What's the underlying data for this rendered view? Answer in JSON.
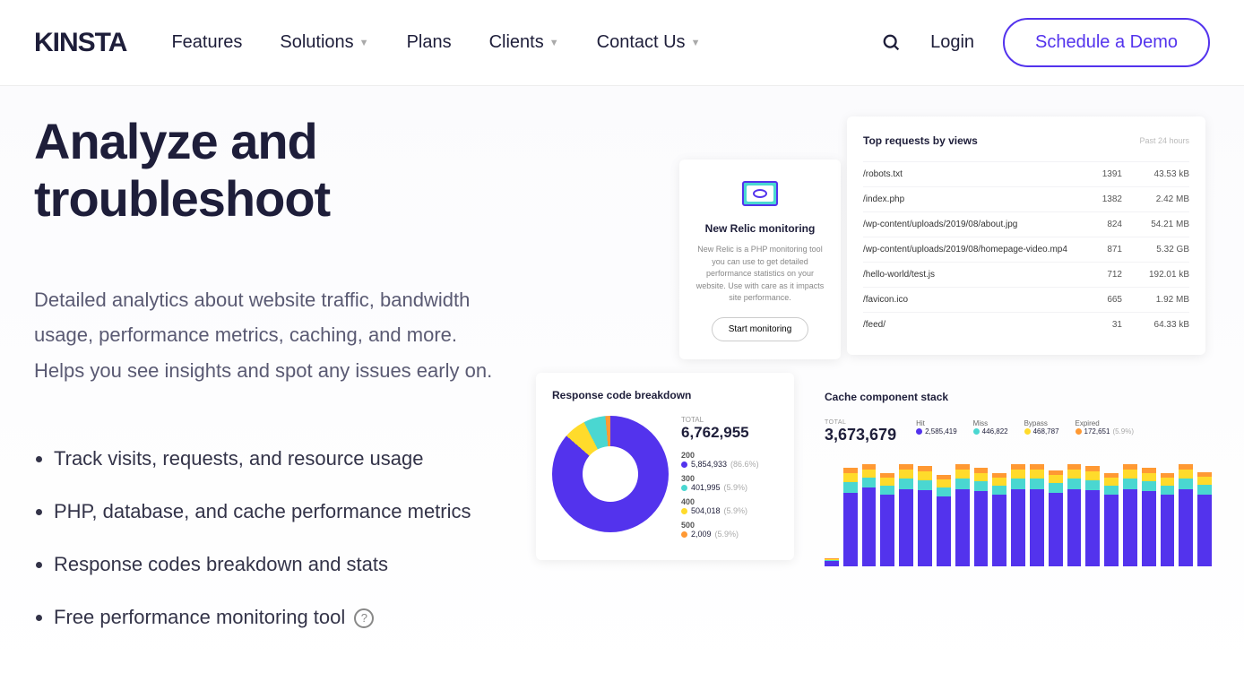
{
  "nav": {
    "logo": "KINSTA",
    "items": [
      "Features",
      "Solutions",
      "Plans",
      "Clients",
      "Contact Us"
    ],
    "dropdowns": [
      false,
      true,
      false,
      true,
      true
    ],
    "login": "Login",
    "cta": "Schedule a Demo"
  },
  "hero": {
    "title": "Analyze and troubleshoot",
    "description": "Detailed analytics about website traffic, bandwidth usage, performance metrics, caching, and more. Helps you see insights and spot any issues early on.",
    "features": [
      "Track visits, requests, and resource usage",
      "PHP, database, and cache performance metrics",
      "Response codes breakdown and stats",
      "Free performance monitoring tool"
    ]
  },
  "newrelic": {
    "title": "New Relic monitoring",
    "desc": "New Relic is a PHP monitoring tool you can use to get detailed performance statistics on your website. Use with care as it impacts site performance.",
    "button": "Start monitoring"
  },
  "requests": {
    "title": "Top requests by views",
    "period": "Past 24 hours",
    "rows": [
      {
        "path": "/robots.txt",
        "views": "1391",
        "size": "43.53 kB"
      },
      {
        "path": "/index.php",
        "views": "1382",
        "size": "2.42 MB"
      },
      {
        "path": "/wp-content/uploads/2019/08/about.jpg",
        "views": "824",
        "size": "54.21 MB"
      },
      {
        "path": "/wp-content/uploads/2019/08/homepage-video.mp4",
        "views": "871",
        "size": "5.32 GB"
      },
      {
        "path": "/hello-world/test.js",
        "views": "712",
        "size": "192.01 kB"
      },
      {
        "path": "/favicon.ico",
        "views": "665",
        "size": "1.92 MB"
      },
      {
        "path": "/feed/",
        "views": "31",
        "size": "64.33 kB"
      }
    ]
  },
  "response": {
    "title": "Response code breakdown",
    "total_label": "TOTAL",
    "total": "6,762,955",
    "codes": [
      {
        "code": "200",
        "value": "5,854,933",
        "pct": "(86.6%)",
        "color": "#5333ed"
      },
      {
        "code": "300",
        "value": "401,995",
        "pct": "(5.9%)",
        "color": "#4ad7d1"
      },
      {
        "code": "400",
        "value": "504,018",
        "pct": "(5.9%)",
        "color": "#ffdb2b"
      },
      {
        "code": "500",
        "value": "2,009",
        "pct": "(5.9%)",
        "color": "#ff9933"
      }
    ]
  },
  "cache": {
    "title": "Cache component stack",
    "total_label": "TOTAL",
    "total": "3,673,679",
    "legend": [
      {
        "label": "Hit",
        "value": "2,585,419",
        "color": "#5333ed"
      },
      {
        "label": "Miss",
        "value": "446,822",
        "color": "#4ad7d1"
      },
      {
        "label": "Bypass",
        "value": "468,787",
        "color": "#ffdb2b"
      },
      {
        "label": "Expired",
        "value": "172,651",
        "pct": "(5.9%)",
        "color": "#ff9933"
      }
    ],
    "chart_data": {
      "type": "bar-stacked",
      "series_colors": [
        "#5333ed",
        "#4ad7d1",
        "#ffdb2b",
        "#ff9933"
      ],
      "bars": [
        [
          6,
          1,
          1,
          1
        ],
        [
          82,
          12,
          10,
          6
        ],
        [
          88,
          11,
          9,
          6
        ],
        [
          80,
          10,
          9,
          5
        ],
        [
          86,
          12,
          10,
          6
        ],
        [
          85,
          11,
          10,
          6
        ],
        [
          78,
          10,
          9,
          5
        ],
        [
          86,
          12,
          10,
          6
        ],
        [
          84,
          11,
          9,
          6
        ],
        [
          80,
          10,
          9,
          5
        ],
        [
          86,
          12,
          10,
          6
        ],
        [
          86,
          12,
          10,
          6
        ],
        [
          82,
          11,
          9,
          5
        ],
        [
          86,
          12,
          10,
          6
        ],
        [
          85,
          11,
          10,
          6
        ],
        [
          80,
          10,
          9,
          5
        ],
        [
          86,
          12,
          10,
          6
        ],
        [
          84,
          11,
          9,
          6
        ],
        [
          80,
          10,
          9,
          5
        ],
        [
          86,
          12,
          10,
          6
        ],
        [
          80,
          11,
          9,
          5
        ]
      ]
    }
  }
}
